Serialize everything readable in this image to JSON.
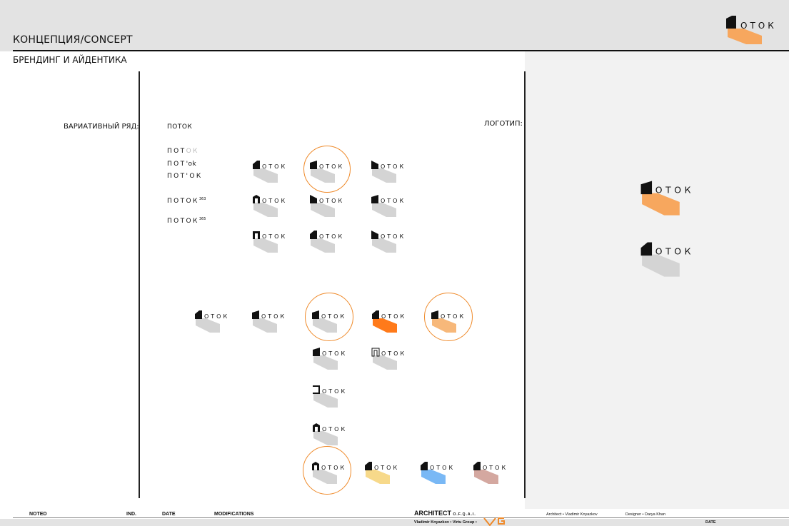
{
  "header": {
    "title": "КОНЦЕПЦИЯ/CONCEPT",
    "subtitle": "БРЕНДИНГ И АЙДЕНТИКА",
    "corner_logo": "ОТОК"
  },
  "labels": {
    "variative": "ВАРИАТИВНЫЙ РЯД:",
    "logotype": "ЛОГОТИП:"
  },
  "variants": {
    "v1": "ПОТОК",
    "v2a": "ПОТ",
    "v2b": "ОК",
    "v3a": "ПОТ",
    "v3b": "'ok",
    "v4": "ПОТ'ОК",
    "v5": "ПОТОК",
    "v5sup": "363",
    "v6": "ПОТОК",
    "v6sup": "365"
  },
  "logo_word": "ОТОК",
  "colors": {
    "shadow": "#d4d4d4",
    "orange": "#f7a75e",
    "orange_bright": "#ff7a1a",
    "orange_soft": "#f7b87a",
    "yellow": "#f7d98a",
    "blue": "#79b8f5",
    "mauve": "#d4a8a0",
    "ring": "#ef8a2a"
  },
  "footer": {
    "noted": "NOTED",
    "ind": "IND.",
    "date": "DATE",
    "modifications": "MODIFICATIONS",
    "architect": "ARCHITECT",
    "architect_sub": "O.F.Q.A.I.",
    "names": "Vladimir Knyazkov • Virtu Group •",
    "architect_credit": "Architect • Vladimir Knyazkov",
    "designer_credit": "Designer • Darya Khan",
    "date_right": "DATE"
  }
}
